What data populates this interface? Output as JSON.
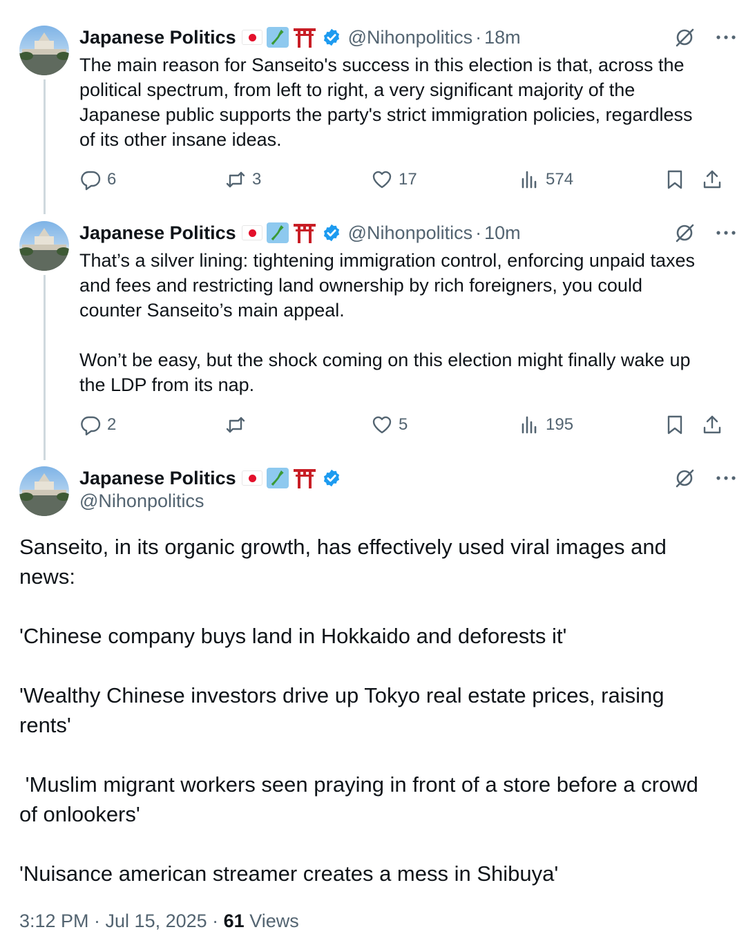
{
  "posts": [
    {
      "name": "Japanese Politics",
      "handle": "@Nihonpolitics",
      "time": "18m",
      "text": "The main reason for Sanseito's success in this election is that, across the\npolitical spectrum, from left to right, a very significant majority of the\nJapanese public supports the party's strict immigration policies, regardless\nof its other insane ideas.",
      "replies": "6",
      "reposts": "3",
      "likes": "17",
      "views": "574"
    },
    {
      "name": "Japanese Politics",
      "handle": "@Nihonpolitics",
      "time": "10m",
      "text": "That’s a silver lining: tightening immigration control, enforcing unpaid taxes\nand fees and restricting land ownership by rich foreigners, you could\ncounter Sanseito’s main appeal.\n\nWon’t be easy, but the shock coming on this election might finally wake up\nthe LDP from its nap.",
      "replies": "2",
      "reposts": "",
      "likes": "5",
      "views": "195"
    }
  ],
  "main_post": {
    "name": "Japanese Politics",
    "handle": "@Nihonpolitics",
    "text": "Sanseito, in its organic growth, has effectively used viral images and\nnews:\n\n'Chinese company buys land in Hokkaido and deforests it'\n\n'Wealthy Chinese investors drive up Tokyo real estate prices, raising\nrents'\n\n 'Muslim migrant workers seen praying in front of a store before a crowd\nof onlookers'\n\n'Nuisance american streamer creates a mess in Shibuya'",
    "timestamp": "3:12 PM · Jul 15, 2025 · ",
    "views_count": "61",
    "views_label": " Views"
  },
  "separator_dot": "·",
  "icons": {
    "name_emojis": [
      "japan-flag-icon",
      "japan-map-icon",
      "torii-gate-icon"
    ],
    "verified": "verified-badge-icon",
    "actions": [
      "reply-icon",
      "repost-icon",
      "like-icon",
      "views-icon",
      "bookmark-icon",
      "share-icon"
    ],
    "header": [
      "grok-icon",
      "more-icon"
    ]
  },
  "colors": {
    "text": "#0f1419",
    "secondary": "#536471",
    "verified": "#1d9bf0",
    "thread_line": "#cfd9de"
  }
}
